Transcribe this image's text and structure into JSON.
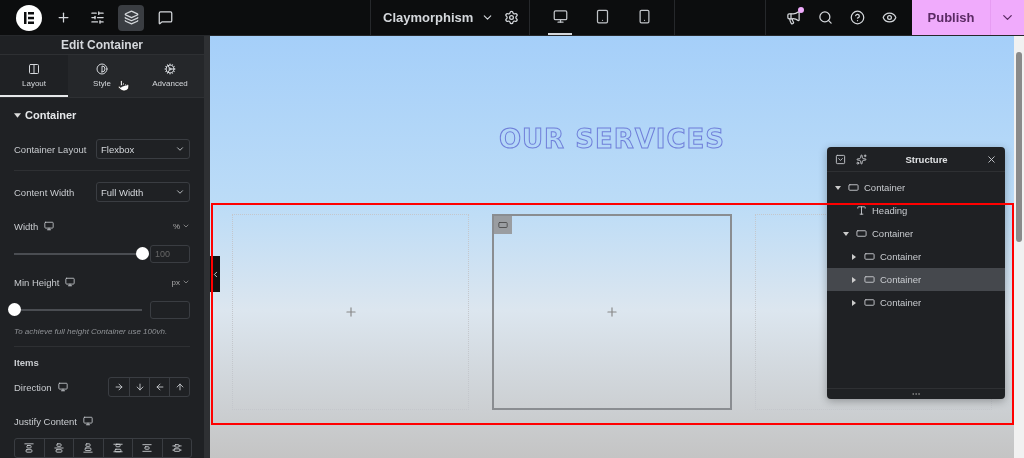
{
  "top_bar": {
    "tools": [
      {
        "kind": "add",
        "selected": false
      },
      {
        "kind": "settings",
        "selected": false
      },
      {
        "kind": "layers",
        "selected": true
      },
      {
        "kind": "comments",
        "selected": false
      }
    ],
    "page_name": "Claymorphism",
    "devices": [
      {
        "kind": "desktop",
        "selected": true
      },
      {
        "kind": "tablet",
        "selected": false
      },
      {
        "kind": "mobile",
        "selected": false
      }
    ],
    "notifications_unread": true,
    "publish": "Publish"
  },
  "panel": {
    "title": "Edit Container",
    "tabs": [
      {
        "label": "Layout",
        "kind": "layout",
        "selected": true
      },
      {
        "label": "Style",
        "kind": "style",
        "selected": false
      },
      {
        "label": "Advanced",
        "kind": "advanced",
        "selected": false
      }
    ],
    "section": {
      "title": "Container",
      "expanded": true
    },
    "controls": [
      {
        "kind": "select",
        "label": "Container Layout",
        "value": "Flexbox"
      },
      {
        "kind": "divider"
      },
      {
        "kind": "select",
        "label": "Content Width",
        "value": "Full Width"
      },
      {
        "kind": "slider",
        "label": "Width",
        "unit": "%",
        "level": 1,
        "placeholder": "100"
      },
      {
        "kind": "slider",
        "label": "Min Height",
        "unit": "px",
        "level": 0
      },
      {
        "kind": "note",
        "text": "To achieve full height Container use 100vh."
      },
      {
        "kind": "divider"
      },
      {
        "kind": "heading",
        "text": "Items"
      },
      {
        "kind": "direction_group",
        "label": "Direction"
      },
      {
        "kind": "justify_group",
        "label": "Justify Content"
      }
    ]
  },
  "canvas": {
    "heading": "OUR SERVICES",
    "columns": [
      {
        "selected": false
      },
      {
        "selected": true
      },
      {
        "selected": false
      }
    ]
  },
  "structure": {
    "title": "Structure",
    "tree": [
      {
        "label": "Container",
        "kind": "container",
        "expanded": true,
        "selected": false,
        "children": [
          {
            "label": "Heading",
            "kind": "heading",
            "selected": false
          },
          {
            "label": "Container",
            "kind": "container",
            "expanded": true,
            "selected": false,
            "children": [
              {
                "label": "Container",
                "kind": "container",
                "expanded": false,
                "selected": false
              },
              {
                "label": "Container",
                "kind": "container",
                "expanded": false,
                "selected": true
              },
              {
                "label": "Container",
                "kind": "container",
                "expanded": false,
                "selected": false
              }
            ]
          }
        ]
      }
    ]
  }
}
